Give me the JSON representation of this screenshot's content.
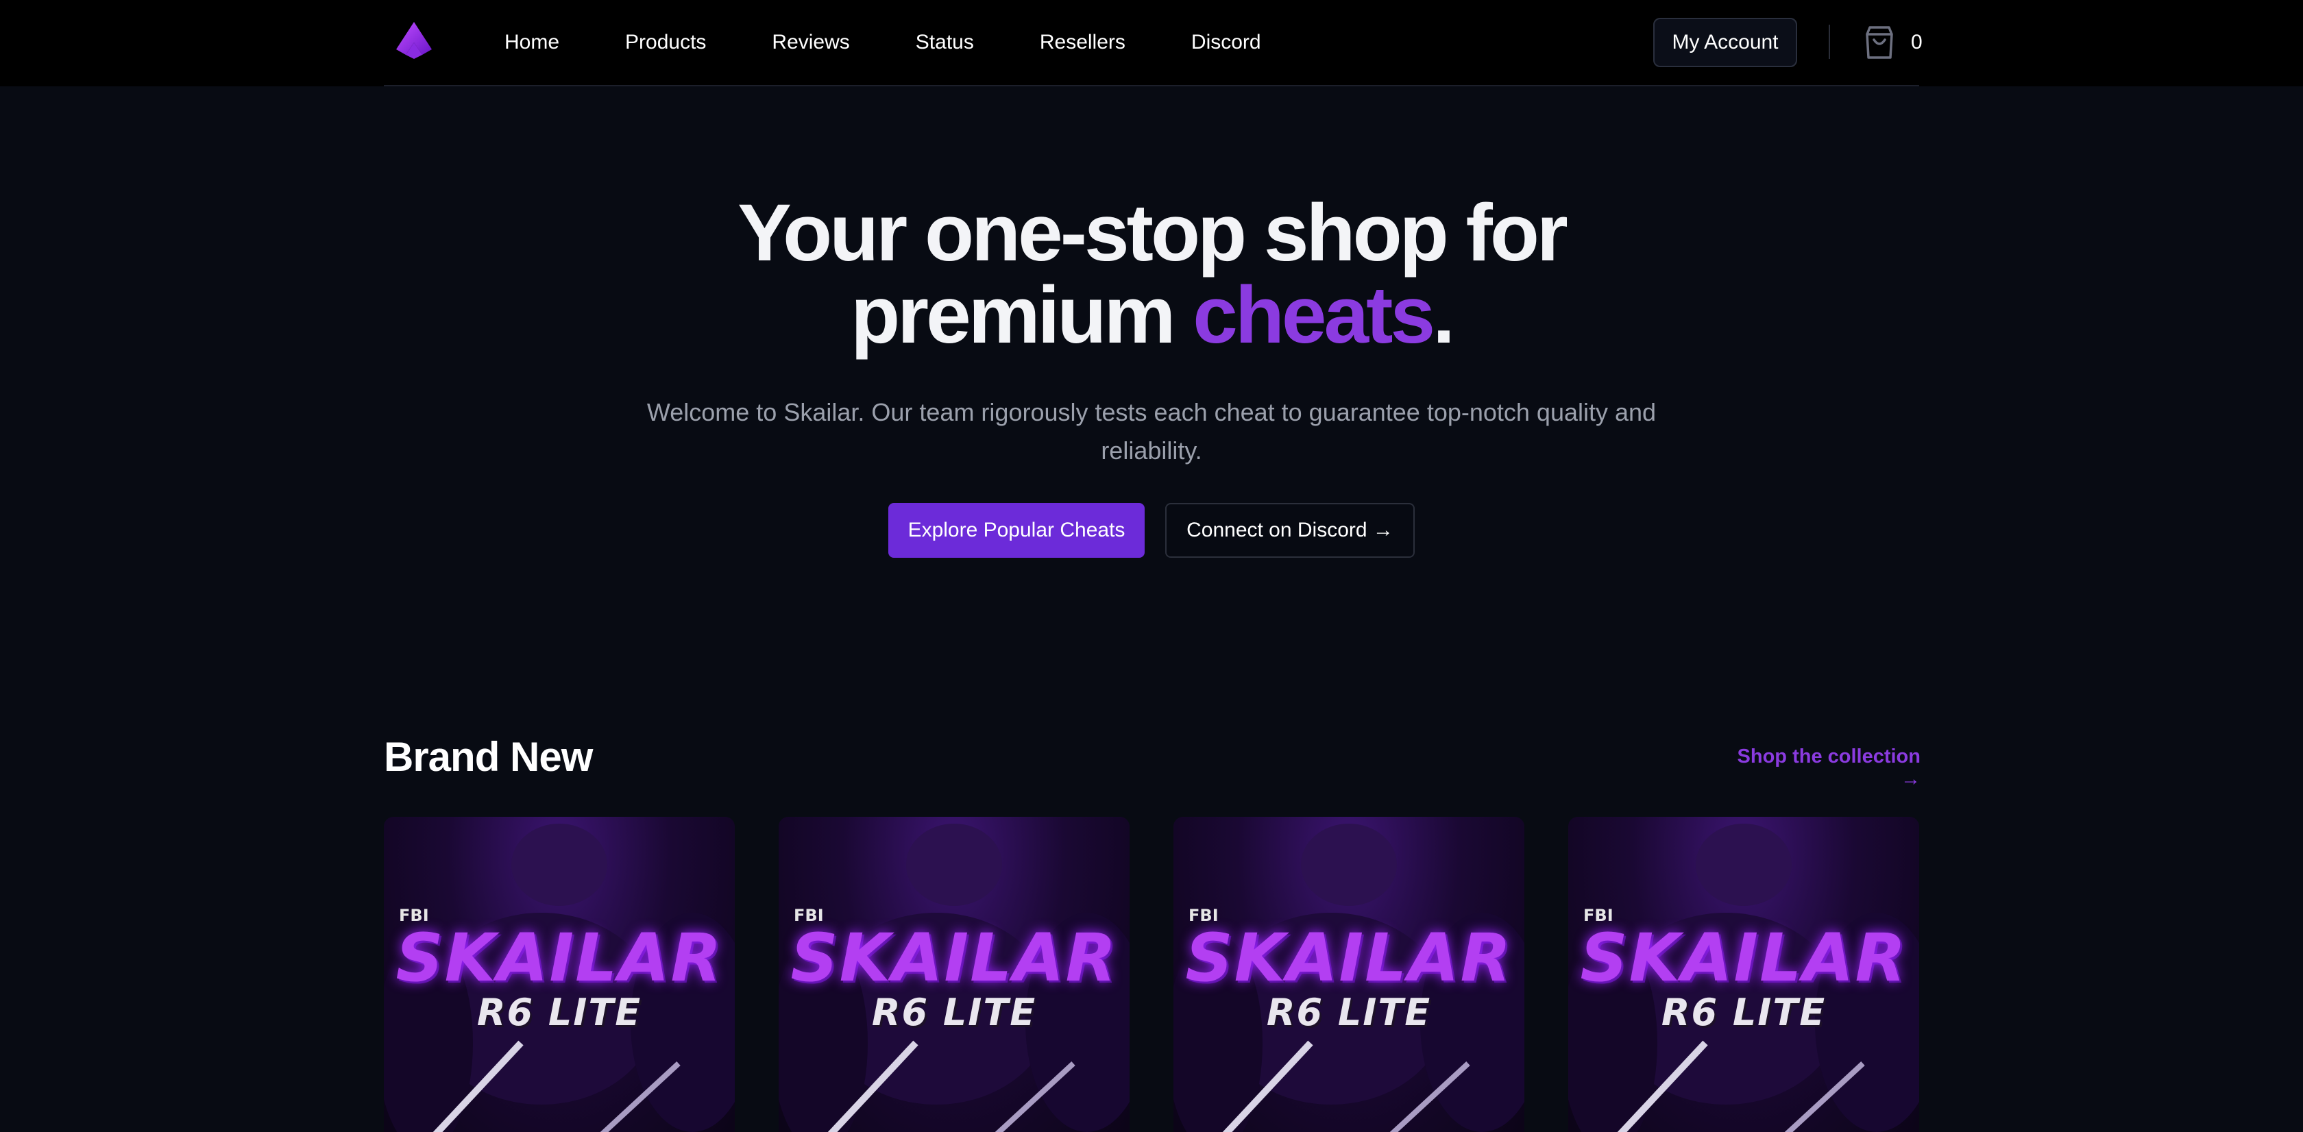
{
  "nav": {
    "links": [
      "Home",
      "Products",
      "Reviews",
      "Status",
      "Resellers",
      "Discord"
    ],
    "account_label": "My Account",
    "cart_count": "0"
  },
  "hero": {
    "title_line1": "Your one-stop shop for",
    "title_line2_plain": "premium ",
    "title_line2_accent": "cheats",
    "title_line2_end": ".",
    "subtitle": "Welcome to Skailar. Our team rigorously tests each cheat to guarantee top-notch quality and reliability.",
    "primary_cta": "Explore Popular Cheats",
    "secondary_cta": "Connect on Discord →"
  },
  "brand_new": {
    "title": "Brand New",
    "shop_link": "Shop the collection →",
    "products": [
      {
        "brand": "SKAILAR",
        "name": "R6 LITE",
        "badge": "FBI"
      },
      {
        "brand": "SKAILAR",
        "name": "R6 LITE",
        "badge": "FBI"
      },
      {
        "brand": "SKAILAR",
        "name": "R6 LITE",
        "badge": "FBI"
      },
      {
        "brand": "SKAILAR",
        "name": "R6 LITE",
        "badge": "FBI"
      }
    ]
  },
  "colors": {
    "accent": "#8b3be0",
    "primary_button": "#6c2bd9",
    "background": "#080b13",
    "nav_background": "#000000"
  },
  "icons": {
    "logo": "skailar-logo-icon",
    "cart": "shopping-bag-icon"
  }
}
